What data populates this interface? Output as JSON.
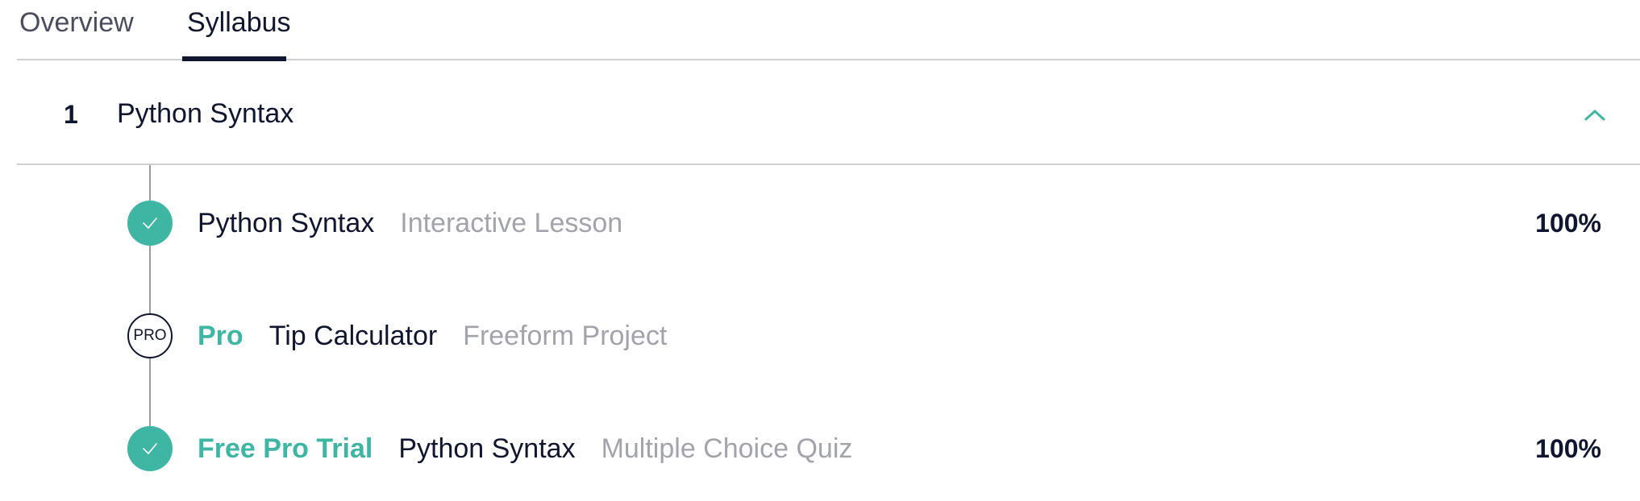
{
  "tabs": [
    {
      "label": "Overview",
      "active": false
    },
    {
      "label": "Syllabus",
      "active": true
    }
  ],
  "module": {
    "number": "1",
    "title": "Python Syntax",
    "expanded": true,
    "toggle_icon": "chevron-up-icon"
  },
  "colors": {
    "accent": "#3fb5a3",
    "text": "#10162f",
    "muted": "#a3a4ab",
    "divider": "#d0d0d4"
  },
  "items": [
    {
      "status_icon": "check-circle-icon",
      "tag": "",
      "name": "Python Syntax",
      "type": "Interactive Lesson",
      "progress": "100%"
    },
    {
      "status_icon": "pro-badge-icon",
      "status_label": "PRO",
      "tag": "Pro",
      "name": "Tip Calculator",
      "type": "Freeform Project",
      "progress": ""
    },
    {
      "status_icon": "check-circle-icon",
      "tag": "Free Pro Trial",
      "name": "Python Syntax",
      "type": "Multiple Choice Quiz",
      "progress": "100%"
    }
  ]
}
